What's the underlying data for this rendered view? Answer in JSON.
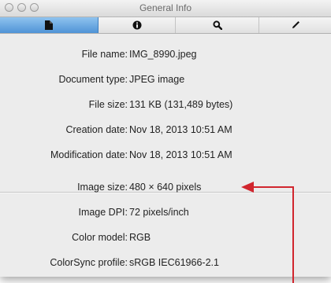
{
  "window": {
    "title": "General Info"
  },
  "toolbar": {
    "tabs": [
      {
        "icon": "document-icon",
        "active": true
      },
      {
        "icon": "info-icon",
        "active": false
      },
      {
        "icon": "search-icon",
        "active": false
      },
      {
        "icon": "pencil-icon",
        "active": false
      }
    ],
    "active_color": "#5c9ee0"
  },
  "info": {
    "file_name": {
      "label": "File name:",
      "value": "IMG_8990.jpeg"
    },
    "document_type": {
      "label": "Document type:",
      "value": "JPEG image"
    },
    "file_size": {
      "label": "File size:",
      "value": "131 KB (131,489 bytes)"
    },
    "creation_date": {
      "label": "Creation date:",
      "value": "Nov 18, 2013 10:51 AM"
    },
    "modification_date": {
      "label": "Modification date:",
      "value": "Nov 18, 2013 10:51 AM"
    },
    "image_size": {
      "label": "Image size:",
      "value": "480 × 640 pixels"
    },
    "image_dpi": {
      "label": "Image DPI:",
      "value": "72 pixels/inch"
    },
    "color_model": {
      "label": "Color model:",
      "value": "RGB"
    },
    "colorsync_profile": {
      "label": "ColorSync profile:",
      "value": "sRGB IEC61966-2.1"
    }
  },
  "annotation": {
    "arrow_color": "#d1262e"
  }
}
